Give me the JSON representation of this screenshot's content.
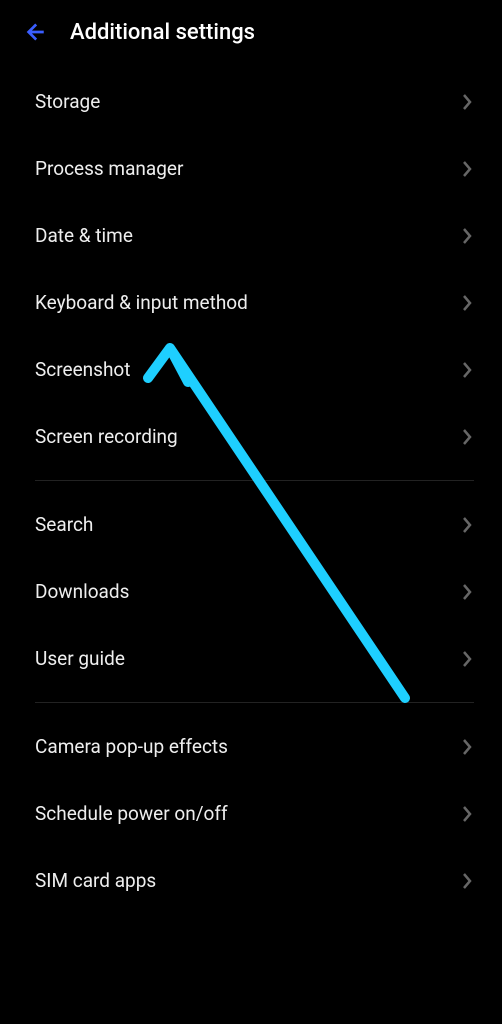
{
  "header": {
    "title": "Additional settings"
  },
  "groups": [
    {
      "items": [
        {
          "id": "storage",
          "label": "Storage"
        },
        {
          "id": "process-manager",
          "label": "Process manager"
        },
        {
          "id": "date-time",
          "label": "Date & time"
        },
        {
          "id": "keyboard-input-method",
          "label": "Keyboard & input method"
        },
        {
          "id": "screenshot",
          "label": "Screenshot"
        },
        {
          "id": "screen-recording",
          "label": "Screen recording"
        }
      ]
    },
    {
      "items": [
        {
          "id": "search",
          "label": "Search"
        },
        {
          "id": "downloads",
          "label": "Downloads"
        },
        {
          "id": "user-guide",
          "label": "User guide"
        }
      ]
    },
    {
      "items": [
        {
          "id": "camera-popup-effects",
          "label": "Camera pop-up effects"
        },
        {
          "id": "schedule-power-onoff",
          "label": "Schedule power on/off"
        },
        {
          "id": "sim-card-apps",
          "label": "SIM card apps"
        }
      ]
    }
  ],
  "annotation": {
    "target": "keyboard-input-method",
    "color": "#1ecfff"
  }
}
